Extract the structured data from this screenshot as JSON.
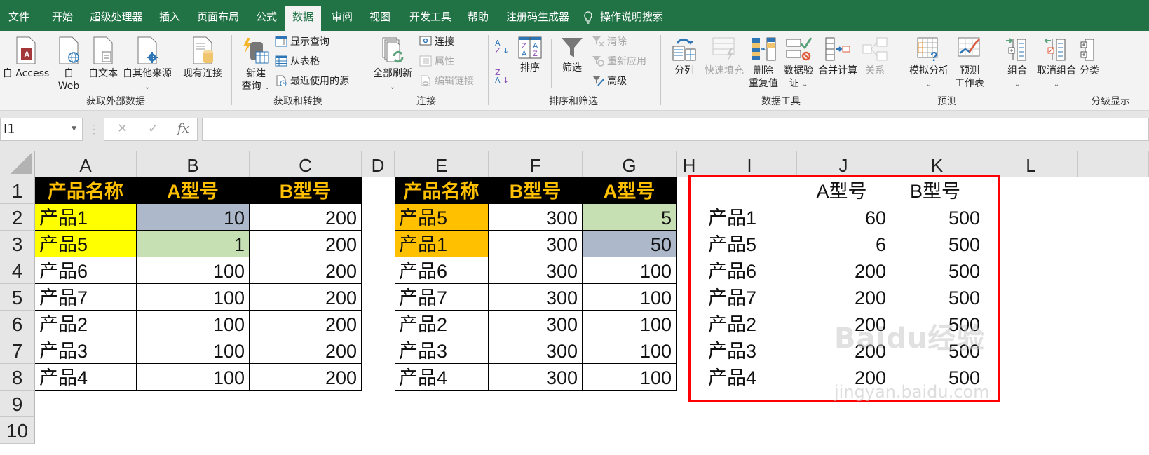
{
  "tabs": [
    {
      "label": "文件",
      "active": false
    },
    {
      "label": "开始",
      "active": false
    },
    {
      "label": "超级处理器",
      "active": false
    },
    {
      "label": "插入",
      "active": false
    },
    {
      "label": "页面布局",
      "active": false
    },
    {
      "label": "公式",
      "active": false
    },
    {
      "label": "数据",
      "active": true
    },
    {
      "label": "审阅",
      "active": false
    },
    {
      "label": "视图",
      "active": false
    },
    {
      "label": "开发工具",
      "active": false
    },
    {
      "label": "帮助",
      "active": false
    },
    {
      "label": "注册码生成器",
      "active": false
    }
  ],
  "tell_me": "操作说明搜索",
  "ribbon": {
    "groups": {
      "get_external": "获取外部数据",
      "get_transform": "获取和转换",
      "connections": "连接",
      "sort_filter": "排序和筛选",
      "data_tools": "数据工具",
      "forecast": "预测",
      "outline": "分级显示"
    },
    "from_access": "自 Access",
    "from_web_1": "自",
    "from_web_2": "Web",
    "from_text": "自文本",
    "from_other": "自其他来源",
    "existing_conn": "现有连接",
    "new_query_1": "新建",
    "new_query_2": "查询",
    "show_queries": "显示查询",
    "from_table": "从表格",
    "recent_sources": "最近使用的源",
    "refresh_all": "全部刷新",
    "connections": "连接",
    "properties": "属性",
    "edit_links": "编辑链接",
    "sort": "排序",
    "filter": "筛选",
    "clear": "清除",
    "reapply": "重新应用",
    "advanced": "高级",
    "text_to_columns": "分列",
    "flash_fill": "快速填充",
    "remove_dup_1": "删除",
    "remove_dup_2": "重复值",
    "validation_1": "数据验",
    "validation_2": "证",
    "consolidate": "合并计算",
    "relationships": "关系",
    "whatif": "模拟分析",
    "forecast_sheet_1": "预测",
    "forecast_sheet_2": "工作表",
    "group": "组合",
    "ungroup": "取消组合",
    "subtotal": "分类"
  },
  "formula_bar": {
    "name_box": "I1",
    "cancel": "✕",
    "enter": "✓",
    "fx": "fx",
    "value": ""
  },
  "columns": [
    "A",
    "B",
    "C",
    "D",
    "E",
    "F",
    "G",
    "H",
    "I",
    "J",
    "K",
    "L"
  ],
  "rows": [
    "1",
    "2",
    "3",
    "4",
    "5",
    "6",
    "7",
    "8",
    "9",
    "10"
  ],
  "table1": {
    "headers": [
      "产品名称",
      "A型号",
      "B型号"
    ],
    "rows": [
      [
        "产品1",
        "10",
        "200"
      ],
      [
        "产品5",
        "1",
        "200"
      ],
      [
        "产品6",
        "100",
        "200"
      ],
      [
        "产品7",
        "100",
        "200"
      ],
      [
        "产品2",
        "100",
        "200"
      ],
      [
        "产品3",
        "100",
        "200"
      ],
      [
        "产品4",
        "100",
        "200"
      ]
    ]
  },
  "table2": {
    "headers": [
      "产品名称",
      "B型号",
      "A型号"
    ],
    "rows": [
      [
        "产品5",
        "300",
        "5"
      ],
      [
        "产品1",
        "300",
        "50"
      ],
      [
        "产品6",
        "300",
        "100"
      ],
      [
        "产品7",
        "300",
        "100"
      ],
      [
        "产品2",
        "300",
        "100"
      ],
      [
        "产品3",
        "300",
        "100"
      ],
      [
        "产品4",
        "300",
        "100"
      ]
    ]
  },
  "table3": {
    "headers": [
      "",
      "A型号",
      "B型号"
    ],
    "rows": [
      [
        "产品1",
        "60",
        "500"
      ],
      [
        "产品5",
        "6",
        "500"
      ],
      [
        "产品6",
        "200",
        "500"
      ],
      [
        "产品7",
        "200",
        "500"
      ],
      [
        "产品2",
        "200",
        "500"
      ],
      [
        "产品3",
        "200",
        "500"
      ],
      [
        "产品4",
        "200",
        "500"
      ]
    ]
  },
  "colors": {
    "excel_green": "#217346",
    "header_fill": "#000000",
    "header_text": "#ffc000",
    "highlight_yellow": "#ffff00",
    "highlight_orange": "#ffc000",
    "fill_blue_gray": "#adb9ca",
    "fill_green": "#c6e0b4",
    "red_box": "#ff0000"
  },
  "watermark": {
    "main": "Baidu经验",
    "sub": "jingyan.baidu.com"
  }
}
